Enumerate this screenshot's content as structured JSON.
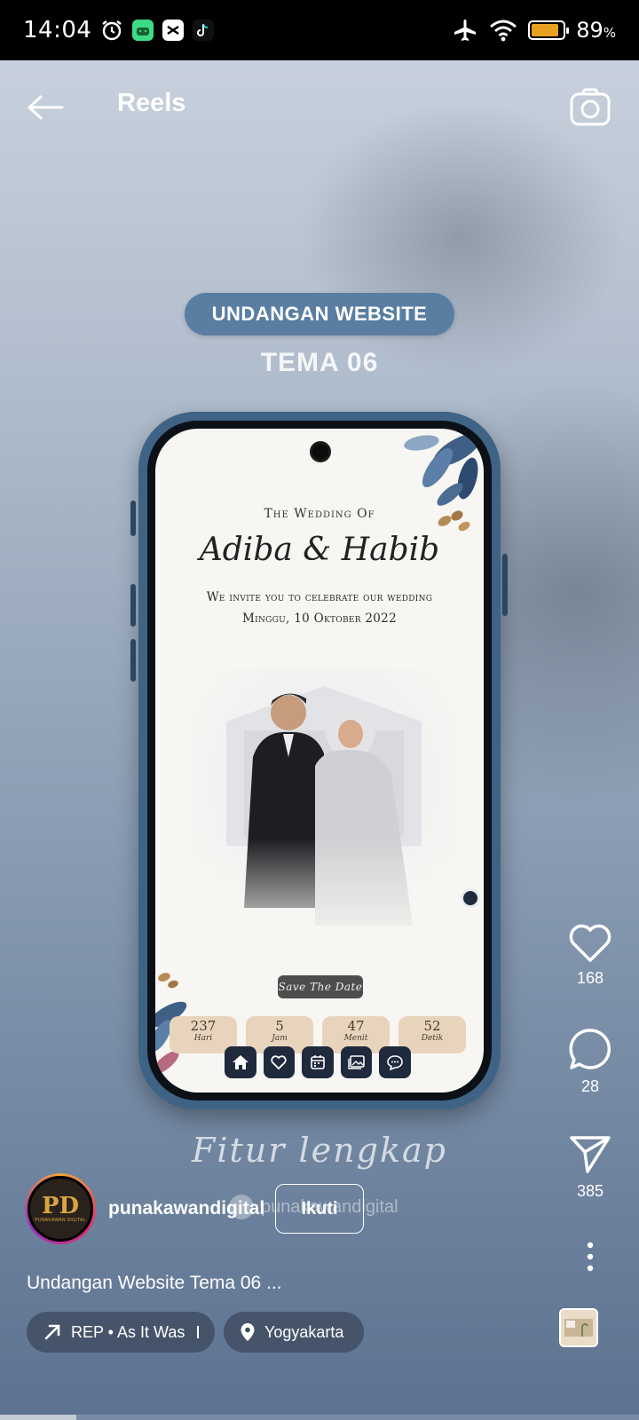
{
  "status_bar": {
    "time": "14:04",
    "battery_pct": "89",
    "battery_sym": "%",
    "battery_level": 0.89
  },
  "header": {
    "title": "Reels"
  },
  "video": {
    "banner": "UNDANGAN WEBSITE",
    "theme": "TEMA 06",
    "invite_title": "The Wedding Of",
    "names": "Adiba & Habib",
    "invite_line": "We invite you to celebrate our wedding",
    "date_line": "Minggu, 10 Oktober 2022",
    "save_the_date": "Save The Date",
    "countdown": [
      {
        "value": "237",
        "unit": "Hari"
      },
      {
        "value": "5",
        "unit": "Jam"
      },
      {
        "value": "47",
        "unit": "Menit"
      },
      {
        "value": "52",
        "unit": "Detik"
      }
    ],
    "overlay_text": "Fitur lengkap",
    "watermark": "punakawandigital"
  },
  "actions": {
    "likes": "168",
    "comments": "28",
    "shares": "385"
  },
  "author": {
    "username": "punakawandigital",
    "follow_label": "Ikuti",
    "avatar_text": "PUNAKAWAN DIGITAL"
  },
  "caption": "Undangan Website Tema 06 ...",
  "chips": {
    "audio": "REP • As It Was",
    "location": "Yogyakarta"
  },
  "colors": {
    "banner": "#5a7ea2",
    "phone_frame": "#3e6384",
    "countdown_tile": "#e8d4bd"
  },
  "progress": 0.12
}
